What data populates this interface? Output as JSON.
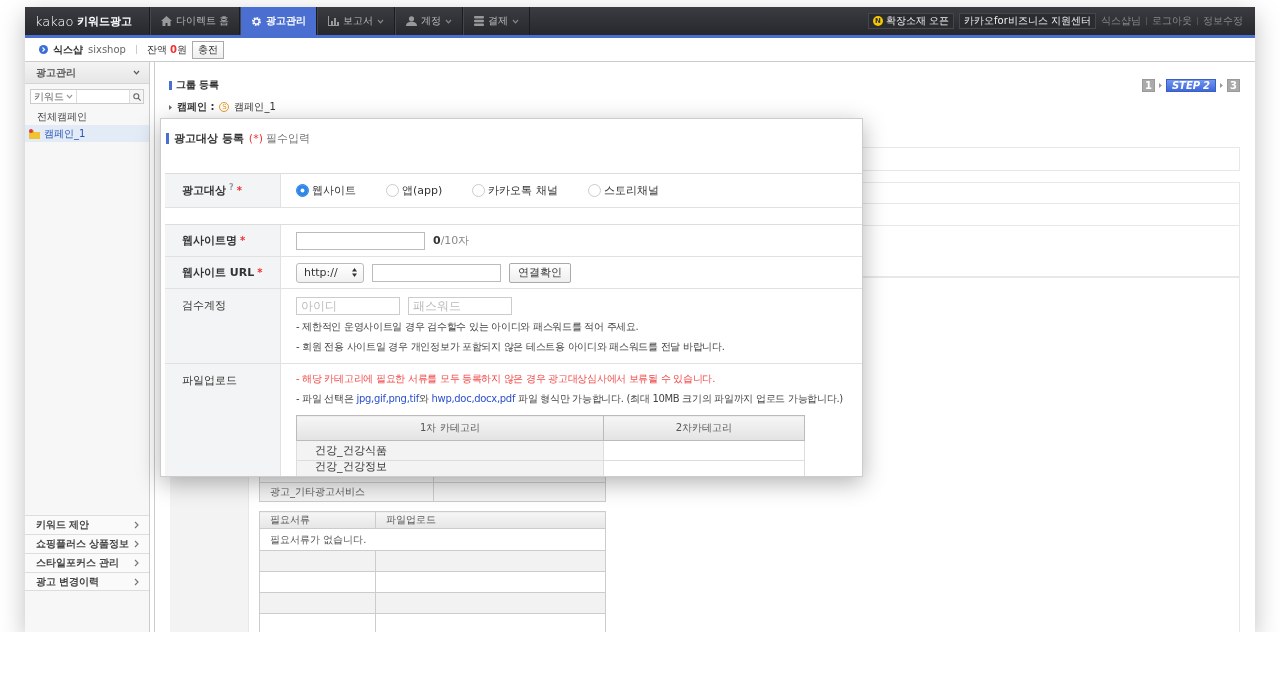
{
  "logo": {
    "brand": "kakao",
    "product": "키워드광고"
  },
  "nav": {
    "items": [
      {
        "label": "다이렉트 홈",
        "selected": false,
        "dropdown": false
      },
      {
        "label": "광고관리",
        "selected": true,
        "dropdown": false
      },
      {
        "label": "보고서",
        "selected": false,
        "dropdown": true
      },
      {
        "label": "계정",
        "selected": false,
        "dropdown": true
      },
      {
        "label": "결제",
        "selected": false,
        "dropdown": true
      }
    ],
    "notice_badge": "N",
    "notice": "확장소재 오픈",
    "support": "카카오for비즈니스 지원센터",
    "links": [
      "식스샵님",
      "로그아웃",
      "정보수정"
    ]
  },
  "account": {
    "name": "식스샵",
    "id": "sixshop",
    "balance_label": "잔액",
    "balance_amount": "0",
    "balance_unit": "원",
    "charge_button": "충전"
  },
  "sidebar": {
    "title": "광고관리",
    "expanded": true,
    "filter": "키워드",
    "items": [
      {
        "label": "전체캠페인",
        "selected": false
      },
      {
        "label": "캠페인_1",
        "selected": true
      }
    ],
    "menu": [
      "키워드 제안",
      "쇼핑플러스 상품정보",
      "스타일포커스 관리",
      "광고 변경이력"
    ]
  },
  "page": {
    "title": "그룹 등록",
    "steps": [
      {
        "number": "1",
        "selected": false
      },
      {
        "prefix": "STEP",
        "number": "2",
        "selected": true
      },
      {
        "number": "3",
        "selected": false
      }
    ],
    "breadcrumb": {
      "label": "캠페인 :",
      "badge": "S",
      "value": "캠페인_1"
    },
    "category_rows": [
      "광고_기타광고서비스"
    ],
    "documents": {
      "columns": [
        "필요서류",
        "파일업로드"
      ],
      "empty_text": "필요서류가 없습니다."
    }
  },
  "popup": {
    "title": "광고대상 등록",
    "required_mark": "(*)",
    "required_note": "필수입력",
    "target": {
      "label": "광고대상",
      "help": "?",
      "required_mark": "*",
      "options": [
        {
          "label": "웹사이트",
          "selected": true
        },
        {
          "label": "앱(app)",
          "selected": false
        },
        {
          "label": "카카오톡 채널",
          "selected": false
        },
        {
          "label": "스토리채널",
          "selected": false
        }
      ]
    },
    "fields": [
      {
        "kind": "text",
        "label": "웹사이트명",
        "required_mark": "*",
        "count": "0",
        "limit": "/10자"
      },
      {
        "kind": "url",
        "label": "웹사이트 URL",
        "required_mark": "*",
        "protocol": "http://",
        "button": "연결확인"
      },
      {
        "kind": "credentials",
        "label": "검수계정",
        "id_placeholder": "아이디",
        "password_placeholder": "패스워드",
        "notes": [
          "- 제한적인 운영사이트일 경우 검수할수 있는 아이디와 패스워드를 적어 주세요.",
          "- 회원 전용 사이트일 경우 개인정보가 포함되지 않은 테스트용 아이디와 패스워드를 전달 바랍니다."
        ]
      },
      {
        "kind": "upload",
        "label": "파일업로드",
        "warning": "- 해당 카테고리에 필요한 서류를 모두 등록하지 않은 경우 광고대상심사에서 보류될 수 있습니다.",
        "note_parts": [
          {
            "text": "- 파일 선택은 ",
            "highlight": false
          },
          {
            "text": "jpg,gif,png,tif",
            "highlight": true
          },
          {
            "text": "와 ",
            "highlight": false
          },
          {
            "text": "hwp,doc,docx,pdf",
            "highlight": true
          },
          {
            "text": " 파일 형식만 가능합니다. (최대 10MB 크기의 파일까지 업로드 가능합니다.)",
            "highlight": false
          }
        ],
        "columns": [
          "1차 카테고리",
          "2차카테고리"
        ],
        "rows": [
          "건강_건강식품",
          "건강_건강정보"
        ]
      }
    ]
  }
}
